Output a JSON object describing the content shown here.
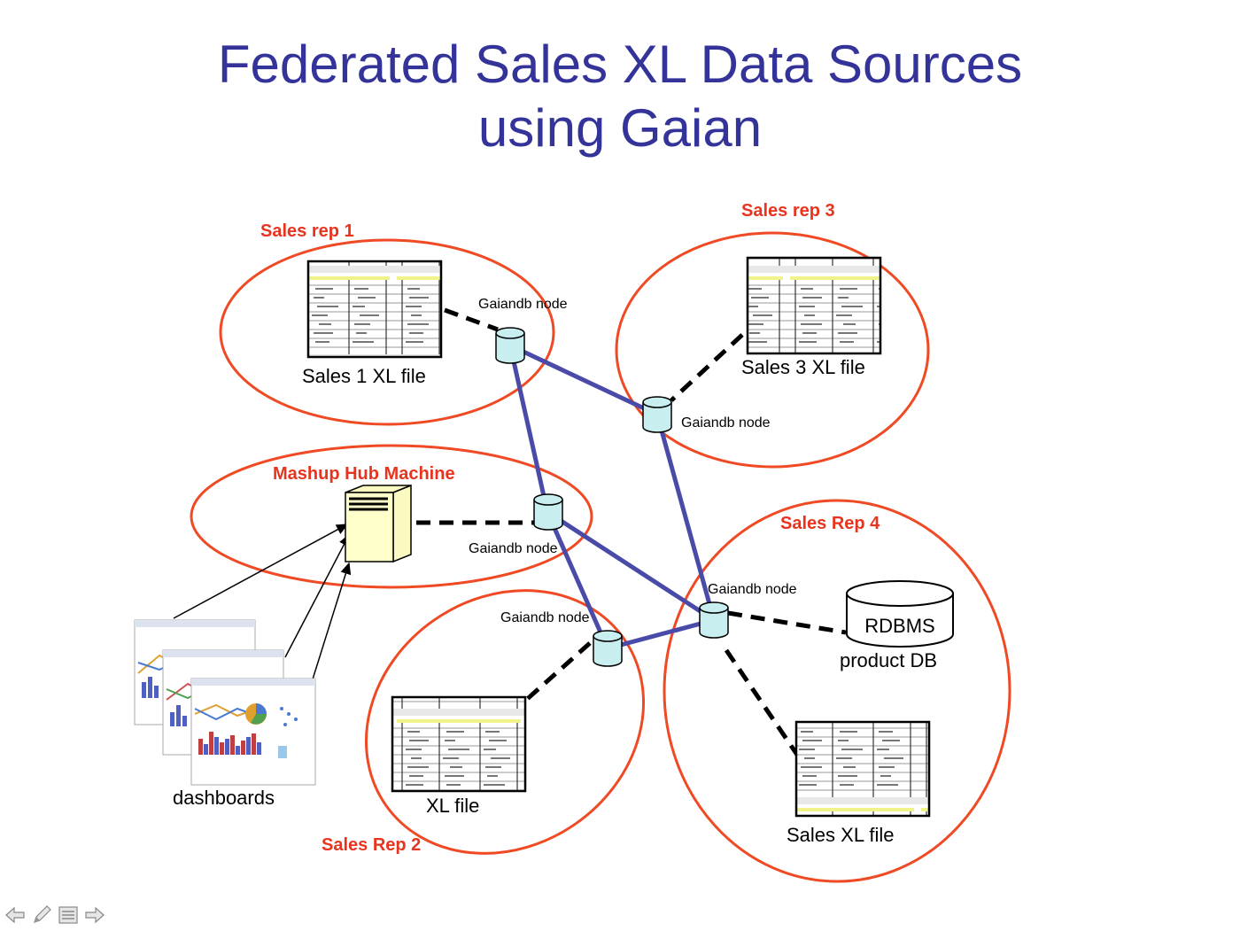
{
  "slide": {
    "title_line1": "Federated Sales XL Data Sources",
    "title_line2": "using Gaian"
  },
  "groups": {
    "sales_rep_1": "Sales rep 1",
    "sales_rep_3": "Sales rep 3",
    "mashup_hub": "Mashup Hub Machine",
    "sales_rep_4": "Sales Rep 4",
    "sales_rep_2": "Sales Rep 2"
  },
  "nodes": {
    "gaian_label": "Gaiandb node"
  },
  "files": {
    "sales1": "Sales 1 XL file",
    "sales3": "Sales 3 XL file",
    "xl": "XL file",
    "salesxl": "Sales XL file"
  },
  "db": {
    "label": "RDBMS",
    "caption": "product DB"
  },
  "dashboards": {
    "caption": "dashboards"
  },
  "colors": {
    "title": "#33339a",
    "group_ellipse": "#f04a25",
    "group_label": "#e8341f",
    "link": "#4a4aa8",
    "node_fill": "#c8eef0"
  },
  "icons": {
    "nav": [
      "arrow-left-icon",
      "pencil-icon",
      "menu-icon",
      "arrow-right-icon"
    ]
  }
}
